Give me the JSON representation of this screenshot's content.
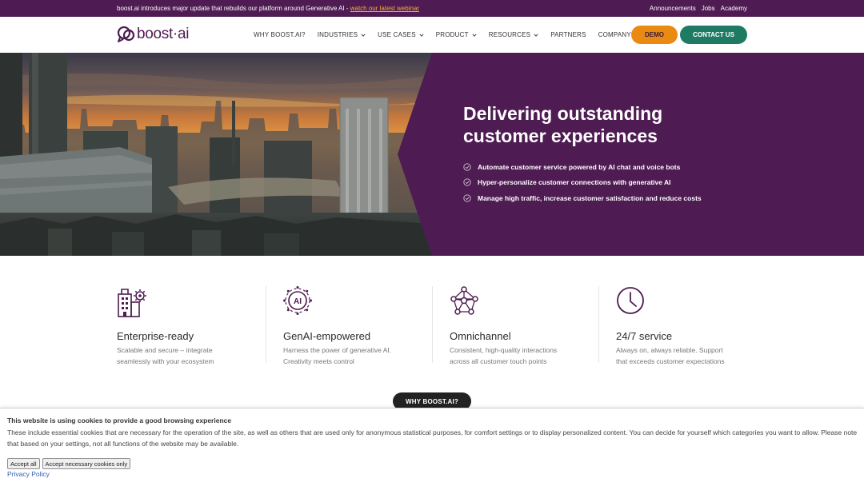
{
  "announcement": {
    "message": "boost.ai introduces major update that rebuilds our platform around Generative AI -",
    "link": "watch our latest webinar",
    "links": [
      "Announcements",
      "Jobs",
      "Academy"
    ]
  },
  "header": {
    "logo_text": "boost·ai",
    "nav": [
      {
        "label": "WHY BOOST.AI?",
        "dropdown": false
      },
      {
        "label": "INDUSTRIES",
        "dropdown": true
      },
      {
        "label": "USE CASES",
        "dropdown": true
      },
      {
        "label": "PRODUCT",
        "dropdown": true
      },
      {
        "label": "RESOURCES",
        "dropdown": true
      },
      {
        "label": "PARTNERS",
        "dropdown": false
      },
      {
        "label": "COMPANY",
        "dropdown": true
      }
    ],
    "demo_label": "DEMO",
    "contact_label": "CONTACT US"
  },
  "hero": {
    "title_line1": "Delivering outstanding",
    "title_line2": "customer experiences",
    "bullets": [
      "Automate customer service powered by AI chat and voice bots",
      "Hyper-personalize customer connections with generative AI",
      "Manage high traffic, increase customer satisfaction and reduce costs"
    ]
  },
  "features": [
    {
      "icon": "building-gear-icon",
      "title": "Enterprise-ready",
      "desc_line1": "Scalable and secure – integrate",
      "desc_line2": "seamlessly with your ecosystem"
    },
    {
      "icon": "ai-chip-icon",
      "title": "GenAI-empowered",
      "desc_line1": "Harness the power of generative AI.",
      "desc_line2": "Creativity meets control"
    },
    {
      "icon": "network-nodes-icon",
      "title": "Omnichannel",
      "desc_line1": "Consistent, high-quality interactions",
      "desc_line2": "across all customer touch points"
    },
    {
      "icon": "clock-icon",
      "title": "24/7 service",
      "desc_line1": "Always on, always reliable. Support",
      "desc_line2": "that exceeds customer expectations"
    }
  ],
  "why_button": "WHY BOOST.AI?",
  "cookie": {
    "title": "This website is using cookies to provide a good browsing experience",
    "text": "These include essential cookies that are necessary for the operation of the site, as well as others that are used only for anonymous statistical purposes, for comfort settings or to display personalized content. You can decide for yourself which categories you want to allow. Please note that based on your settings, not all functions of the website may be available.",
    "accept_all": "Accept all",
    "accept_necessary": "Accept necessary cookies only",
    "privacy": "Privacy Policy"
  },
  "colors": {
    "brand_purple": "#4e1b52",
    "demo_orange": "#ea8a12",
    "contact_green": "#1f7a63",
    "link_yellow": "#f2b233"
  }
}
